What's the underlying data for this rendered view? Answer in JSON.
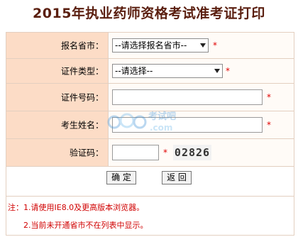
{
  "title": "2015年执业药师资格考试准考证打印",
  "form": {
    "province": {
      "label": "报名省市：",
      "value": "--请选择报名省市--",
      "required": "*"
    },
    "id_type": {
      "label": "证件类型：",
      "value": "--请选择--",
      "required": "*"
    },
    "id_number": {
      "label": "证件号码：",
      "value": "",
      "required": "*"
    },
    "name": {
      "label": "考生姓名：",
      "value": "",
      "required": "*"
    },
    "captcha": {
      "label": "验证码：",
      "value": "",
      "required": "*",
      "image_text": "02826"
    }
  },
  "buttons": {
    "confirm": "确 定",
    "back": "返 回"
  },
  "notes": [
    "注：1.请使用IE8.0及更高版本浏览器。",
    "2.当前未开通省市不在列表中显示。"
  ],
  "watermark": {
    "text": "考试吧",
    "sub": ".com"
  },
  "colors": {
    "label_bg": "#fcdcc6",
    "border": "#e3cfc0",
    "title": "#5a1e0f",
    "required": "#e00000"
  }
}
